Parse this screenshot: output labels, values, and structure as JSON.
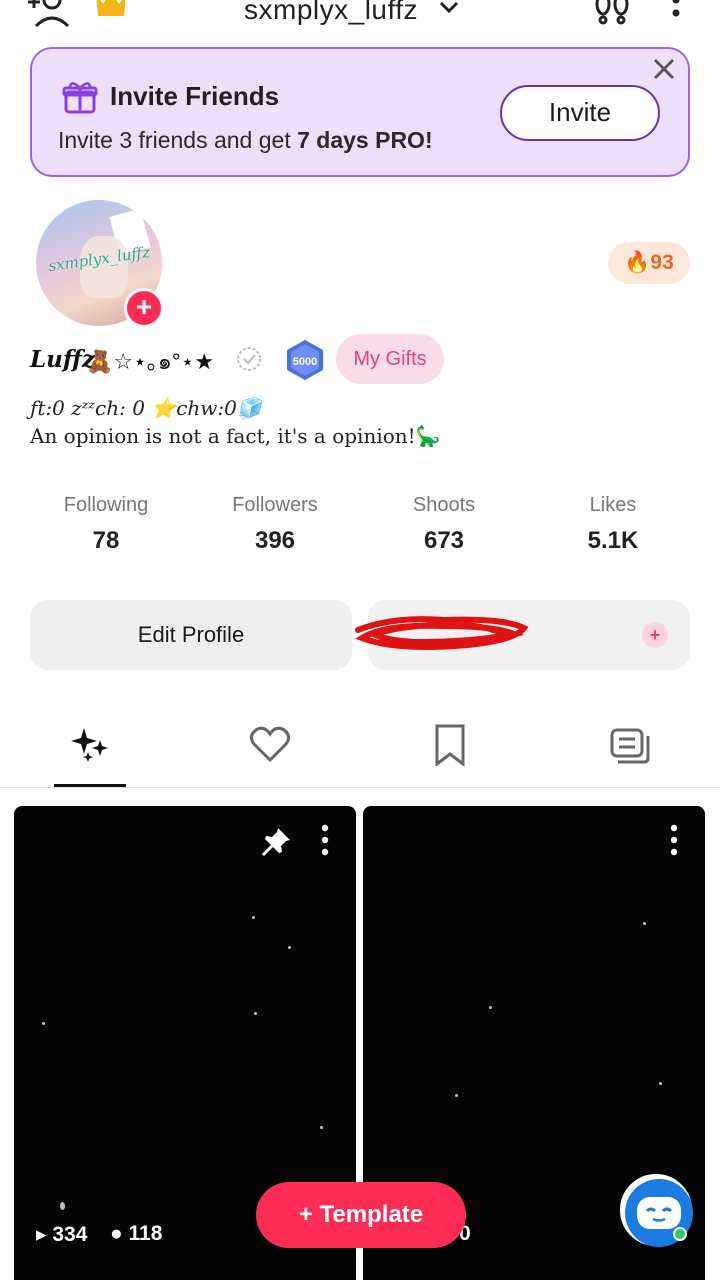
{
  "header": {
    "username": "sxmplyx_luffz"
  },
  "invite": {
    "title": "Invite Friends",
    "subtitle_pre": "Invite 3 friends and get ",
    "subtitle_bold": "7 days PRO!",
    "button": "Invite"
  },
  "profile": {
    "avatar_text": "sxmplyx_luffz",
    "streak": "93",
    "name": "Luffz",
    "name_deco": "🧸☆⋆｡๑°⋆★",
    "badge": "5000",
    "gifts_label": "My Gifts",
    "bio_line1": "ƒt:0 zᶻᶻch: 0 ⭐chw:0🧊",
    "bio_line2": "An opinion is not a fact, it's a opinion!🦕"
  },
  "stats": [
    {
      "label": "Following",
      "value": "78"
    },
    {
      "label": "Followers",
      "value": "396"
    },
    {
      "label": "Shoots",
      "value": "673"
    },
    {
      "label": "Likes",
      "value": "5.1K"
    }
  ],
  "actions": {
    "edit_profile": "Edit Profile",
    "add": "+"
  },
  "posts": [
    {
      "plays": "▸ 334",
      "likes": "● 118"
    },
    {
      "tail": "0"
    }
  ],
  "fab": {
    "template_label": "+ Template"
  },
  "colors": {
    "accent": "#fe2c55",
    "invite_bg": "#ede0fa",
    "invite_border": "#9b64e6",
    "streak": "#e76a20"
  }
}
